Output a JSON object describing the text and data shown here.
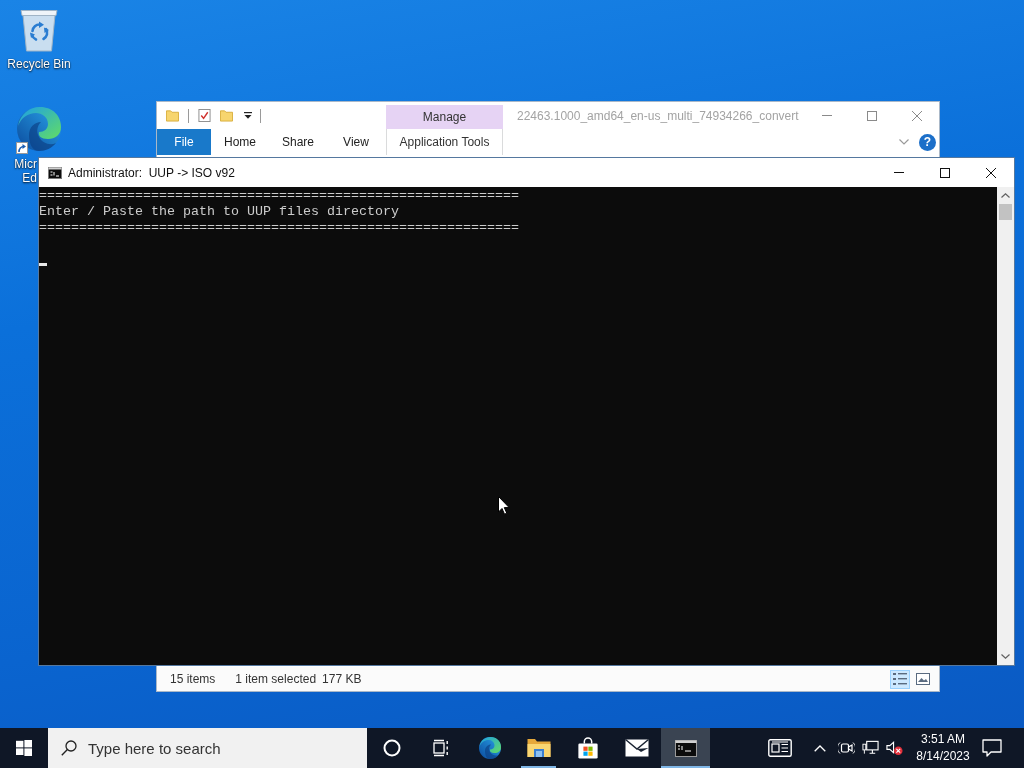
{
  "desktop_icons": [
    {
      "kind": "recycle_bin",
      "label": "Recycle Bin"
    },
    {
      "kind": "edge_shortcut",
      "label": "Micr Ed"
    }
  ],
  "explorer": {
    "title": "22463.1000_amd64_en-us_multi_74934266_convert",
    "context_group": "Manage",
    "tabs": [
      {
        "kind": "file",
        "label": "File"
      },
      {
        "kind": "tab",
        "label": "Home"
      },
      {
        "kind": "tab",
        "label": "Share"
      },
      {
        "kind": "tab",
        "label": "View"
      },
      {
        "kind": "context",
        "label": "Application Tools"
      }
    ],
    "help_label": "?",
    "status_bar": {
      "item_count": "15 items",
      "selection": "1 item selected",
      "size": "177 KB"
    },
    "view_buttons": [
      {
        "kind": "details",
        "selected": true
      },
      {
        "kind": "large_icons",
        "selected": false
      }
    ]
  },
  "console": {
    "title": "Administrator:  UUP -> ISO v92",
    "lines": [
      {
        "kind": "text",
        "text": "============================================================"
      },
      {
        "kind": "text",
        "text": "Enter / Paste the path to UUP files directory"
      },
      {
        "kind": "text",
        "text": "============================================================"
      },
      {
        "kind": "blank"
      },
      {
        "kind": "cursor"
      }
    ]
  },
  "taskbar": {
    "search": {
      "placeholder": "Type here to search"
    },
    "apps": [
      {
        "kind": "cortana",
        "running": false,
        "active": false
      },
      {
        "kind": "task_view",
        "running": false,
        "active": false
      },
      {
        "kind": "edge",
        "running": false,
        "active": false
      },
      {
        "kind": "file_explorer",
        "running": true,
        "active": false
      },
      {
        "kind": "store",
        "running": false,
        "active": false
      },
      {
        "kind": "mail",
        "running": false,
        "active": false
      },
      {
        "kind": "terminal",
        "running": true,
        "active": true
      }
    ],
    "clock": {
      "time": "3:51 AM",
      "date": "8/14/2023"
    }
  }
}
